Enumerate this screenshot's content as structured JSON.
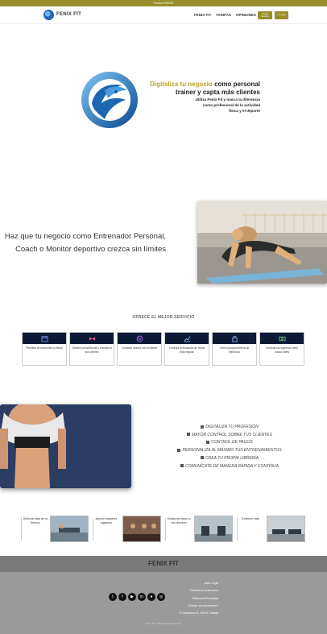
{
  "topbar": {
    "text": "Prueba GRATIS"
  },
  "nav": {
    "brand": "FENIX FIT",
    "links": [
      "FENIX FIT",
      "TARIFAS",
      "OPINIONES"
    ],
    "login_button": "Iniciar Sesión",
    "register_button": "Ir Login"
  },
  "hero": {
    "accent": "Digitaliza tu negocio",
    "line1_rest": " como personal",
    "line2": "trainer y capta más clientes",
    "small": [
      "Utiliza Fenix Fit y marca la diferencia",
      "como profesional de la actividad",
      "física y el deporte"
    ]
  },
  "lead": {
    "line1": "Haz que tu negocio como Entrenador Personal,",
    "line2": "Coach o Monitor deportivo crezca sin límites"
  },
  "services": {
    "title": "OFRECE EL MEJOR SERVICIO",
    "cards": [
      {
        "icon": "calendar-icon",
        "text": "Planifica de forma fácil y eficaz"
      },
      {
        "icon": "dumbbell-icon",
        "text": "Genera tus Workouts y envíalos a sus clientes"
      },
      {
        "icon": "chat-icon",
        "text": "Contacto directo con el cliente"
      },
      {
        "icon": "chart-icon",
        "text": "Controla la evolución de forma más regular"
      },
      {
        "icon": "lock-icon",
        "text": "Crea tu propia librería de ejercicios"
      },
      {
        "icon": "money-icon",
        "text": "Controla tus ingresos como nunca antes"
      }
    ]
  },
  "features": [
    "DIGITALIZA TU PROFESIÓN",
    "MAYOR CONTROL SOBRE TUS CLIENTES",
    "CONTROL DE PAGOS",
    "PERSONALIZA AL MÁXIMO TUS ENTRENAMIENTOS",
    "CREA TU PROPIA LIBRERÍA",
    "COMUNÍCATE DE MANERA RÁPIDA Y CONTÍNUA"
  ],
  "benefits": [
    {
      "text": "Disfruta más de tu tiempo"
    },
    {
      "text": "Aporta mayores ingresos"
    },
    {
      "text": "Gestiona mejor a tus clientes"
    },
    {
      "text": "Entrena más"
    }
  ],
  "footer": {
    "brand": "FENIX FIT",
    "socials": [
      "twitter-icon",
      "facebook-icon",
      "youtube-icon",
      "linkedin-icon",
      "github-icon",
      "instagram-icon"
    ],
    "links": [
      "Aviso Legal",
      "Términos y condiciones",
      "Política de Privacidad",
      "¿Dónde nos encuentras?",
      "C/ Inventada 01, 29010, Málaga"
    ],
    "copyright": "Fenix Fit © 2021 All rights reserved"
  },
  "colors": {
    "accent": "#9a8e2b",
    "card_header": "#0c1a36",
    "footer": "#9a9a9a"
  }
}
